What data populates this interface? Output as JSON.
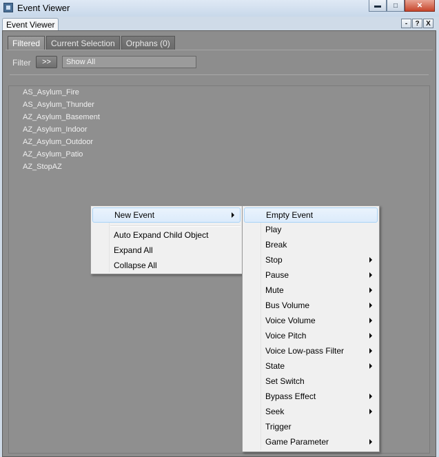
{
  "window": {
    "title": "Event Viewer"
  },
  "panel": {
    "tab_label": "Event Viewer",
    "buttons": [
      "-",
      "?",
      "X"
    ]
  },
  "tabs": [
    {
      "label": "Filtered",
      "active": true
    },
    {
      "label": "Current Selection",
      "active": false
    },
    {
      "label": "Orphans (0)",
      "active": false
    }
  ],
  "filter": {
    "label": "Filter",
    "toggle_label": ">>",
    "value": "Show All"
  },
  "events": [
    "AS_Asylum_Fire",
    "AS_Asylum_Thunder",
    "AZ_Asylum_Basement",
    "AZ_Asylum_Indoor",
    "AZ_Asylum_Outdoor",
    "AZ_Asylum_Patio",
    "AZ_StopAZ"
  ],
  "context_menu": {
    "items": [
      {
        "label": "New Event",
        "submenu": true
      },
      {
        "label": "Auto Expand Child Object",
        "submenu": false
      },
      {
        "label": "Expand All",
        "submenu": false
      },
      {
        "label": "Collapse All",
        "submenu": false
      }
    ]
  },
  "submenu": {
    "items": [
      {
        "label": "Empty Event",
        "submenu": false
      },
      {
        "label": "Play",
        "submenu": false
      },
      {
        "label": "Break",
        "submenu": false
      },
      {
        "label": "Stop",
        "submenu": true
      },
      {
        "label": "Pause",
        "submenu": true
      },
      {
        "label": "Mute",
        "submenu": true
      },
      {
        "label": "Bus Volume",
        "submenu": true
      },
      {
        "label": "Voice Volume",
        "submenu": true
      },
      {
        "label": "Voice Pitch",
        "submenu": true
      },
      {
        "label": "Voice Low-pass Filter",
        "submenu": true
      },
      {
        "label": "State",
        "submenu": true
      },
      {
        "label": "Set Switch",
        "submenu": false
      },
      {
        "label": "Bypass Effect",
        "submenu": true
      },
      {
        "label": "Seek",
        "submenu": true
      },
      {
        "label": "Trigger",
        "submenu": false
      },
      {
        "label": "Game Parameter",
        "submenu": true
      }
    ]
  }
}
